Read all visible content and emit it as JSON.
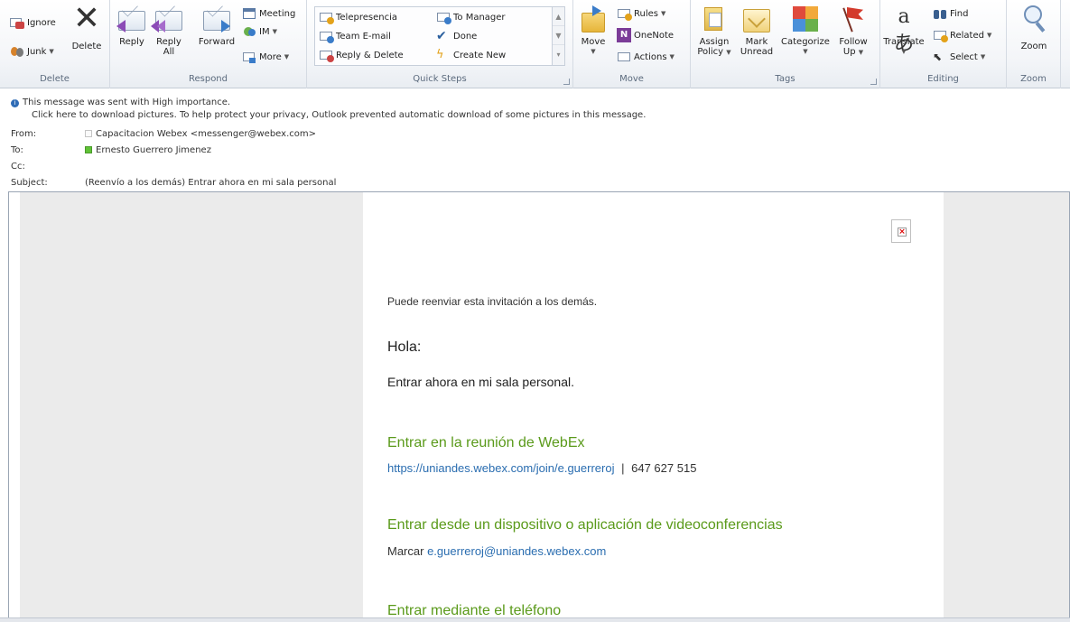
{
  "ribbon": {
    "delete_group": {
      "label": "Delete",
      "ignore": "Ignore",
      "junk": "Junk",
      "delete": "Delete"
    },
    "respond_group": {
      "label": "Respond",
      "reply": "Reply",
      "reply_all_1": "Reply",
      "reply_all_2": "All",
      "forward": "Forward",
      "meeting": "Meeting",
      "im": "IM",
      "more": "More"
    },
    "quick_steps": {
      "label": "Quick Steps",
      "items": [
        "Telepresencia",
        "To Manager",
        "Team E-mail",
        "Done",
        "Reply & Delete",
        "Create New"
      ]
    },
    "move_group": {
      "label": "Move",
      "move": "Move",
      "rules": "Rules",
      "onenote": "OneNote",
      "actions": "Actions"
    },
    "tags_group": {
      "label": "Tags",
      "assign_1": "Assign",
      "assign_2": "Policy",
      "mark_1": "Mark",
      "mark_2": "Unread",
      "categorize": "Categorize",
      "follow_1": "Follow",
      "follow_2": "Up"
    },
    "editing_group": {
      "label": "Editing",
      "translate": "Translate",
      "find": "Find",
      "related": "Related",
      "select": "Select"
    },
    "zoom_group": {
      "label": "Zoom",
      "zoom": "Zoom"
    }
  },
  "header": {
    "importance": "This message was sent with High importance.",
    "pictures": "Click here to download pictures. To help protect your privacy, Outlook prevented automatic download of some pictures in this message.",
    "from_label": "From:",
    "from_value": "Capacitacion Webex <messenger@webex.com>",
    "to_label": "To:",
    "to_value": "Ernesto  Guerrero Jimenez",
    "cc_label": "Cc:",
    "subject_label": "Subject:",
    "subject_value": "(Reenvío a los demás) Entrar ahora en mi sala personal"
  },
  "email": {
    "forward_note": "Puede reenviar esta invitación a los demás.",
    "greeting": "Hola:",
    "intro": "Entrar ahora en mi sala personal.",
    "join_heading": "Entrar en la reunión de WebEx",
    "join_link": "https://uniandes.webex.com/join/e.guerreroj",
    "join_separator": "|",
    "meeting_number": "647 627 515",
    "device_heading": "Entrar desde un dispositivo o aplicación de videoconferencias",
    "dial_label": "Marcar",
    "dial_address": "e.guerreroj@uniandes.webex.com",
    "phone_heading": "Entrar mediante el teléfono"
  },
  "colors": {
    "accent_green": "#5a9a1a",
    "link_blue": "#2a6db0",
    "flag_red": "#d33a2c"
  }
}
